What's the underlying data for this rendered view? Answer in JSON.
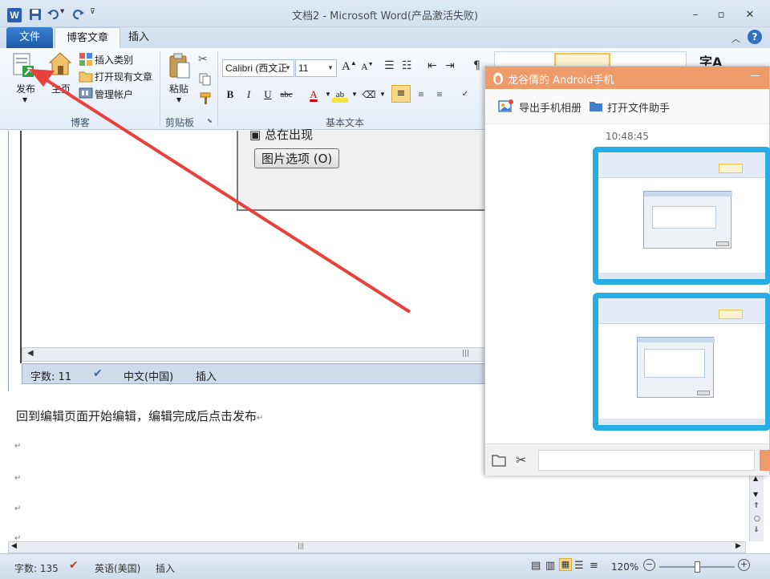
{
  "window": {
    "title": "文档2 - Microsoft Word(产品激活失败)"
  },
  "tabs": {
    "file": "文件",
    "blog": "博客文章",
    "insert": "插入"
  },
  "ribbon": {
    "publish_label": "发布",
    "home_label": "主页",
    "insert_category": "插入类别",
    "open_existing": "打开现有文章",
    "manage_account": "管理帐户",
    "paste_label": "粘贴",
    "font_name": "Calibri (西文正",
    "font_size": "11",
    "style_text": "字A",
    "groups": {
      "blog": "博客",
      "clipboard": "剪贴板",
      "basic_text": "基本文本"
    }
  },
  "embedded": {
    "option_text": "总在出现",
    "picture_options": "图片选项 (O)",
    "status": {
      "word_count": "字数: 11",
      "language": "中文(中国)",
      "mode": "插入"
    }
  },
  "document": {
    "instruction": "回到编辑页面开始编辑，编辑完成后点击发布",
    "para_mark": "↵"
  },
  "statusbar": {
    "word_count": "字数: 135",
    "language": "英语(美国)",
    "mode": "插入",
    "zoom": "120%"
  },
  "chat": {
    "title": "龙谷倩的 Android手机",
    "export_album": "导出手机相册",
    "open_assistant": "打开文件助手",
    "timestamp": "10:48:45",
    "minimize": "—"
  },
  "colors": {
    "chat_header": "#ef9a6b",
    "bubble": "#25aee5",
    "arrow": "#e8403a"
  }
}
